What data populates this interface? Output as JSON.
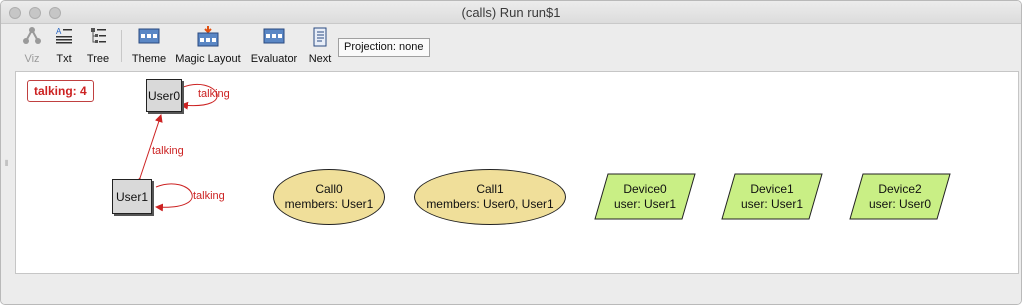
{
  "window": {
    "title": "(calls) Run run$1"
  },
  "toolbar": {
    "viz": "Viz",
    "txt": "Txt",
    "tree": "Tree",
    "theme": "Theme",
    "magic_layout": "Magic Layout",
    "evaluator": "Evaluator",
    "next": "Next",
    "projection": "Projection: none"
  },
  "graph": {
    "badge": "talking: 4",
    "users": [
      {
        "label": "User0"
      },
      {
        "label": "User1"
      }
    ],
    "calls": [
      {
        "title": "Call0",
        "detail": "members: User1"
      },
      {
        "title": "Call1",
        "detail": "members: User0, User1"
      }
    ],
    "devices": [
      {
        "title": "Device0",
        "detail": "user: User1"
      },
      {
        "title": "Device1",
        "detail": "user: User1"
      },
      {
        "title": "Device2",
        "detail": "user: User0"
      }
    ],
    "edges": [
      {
        "label": "talking"
      },
      {
        "label": "talking"
      },
      {
        "label": "talking"
      }
    ]
  },
  "colors": {
    "edge": "#cc2222",
    "user_fill": "#d9d9d9",
    "call_fill": "#f0df9a",
    "device_fill": "#c9ef85"
  }
}
